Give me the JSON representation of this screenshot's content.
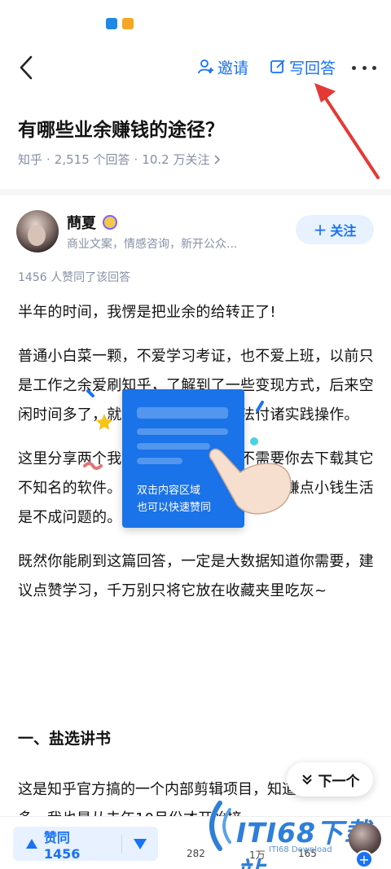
{
  "nav": {
    "invite_label": "邀请",
    "write_answer_label": "写回答"
  },
  "question": {
    "title": "有哪些业余赚钱的途径？",
    "source": "知乎",
    "answer_count": "2,515 个回答",
    "follower_count": "10.2 万关注"
  },
  "author": {
    "name": "蔄夏",
    "bio": "商业文案，情感咨询，新开公众...",
    "follow_label": "关注"
  },
  "answer": {
    "likers_text": "1456 人赞同了该回答",
    "paragraphs": [
      "半年的时间，我愣是把业余的给转正了!",
      "普通小白菜一颗，不爱学习考证，也不爱上班，以前只是工作之余爱刷知乎，了解到了一些变现方式，后来空闲时间多了，就把了解到的这些方法付诸实践操作。",
      "这里分享两个我觉得不错的副业，不需要你去下载其它不知名的软件。就在知乎，稍稍努力一点赚点小钱生活是不成问题的。",
      "既然你能刷到这篇回答，一定是大数据知道你需要，建议点赞学习，千万别只将它放在收藏夹里吃灰~"
    ],
    "section_title": "一、盐选讲书",
    "last_paragraph": "这是知乎官方搞的一个内部剪辑项目，知道的人并不多，我也是从去年10月份才开始接"
  },
  "tip": {
    "line1": "双击内容区域",
    "line2": "也可以快速赞同"
  },
  "next_label": "下一个",
  "bottom": {
    "vote_label": "赞同 1456",
    "comments": "282",
    "favorites": "1万",
    "likes": "165"
  },
  "watermark": {
    "main": "ITI68下载站",
    "sub": "ITI68 Download"
  },
  "colors": {
    "accent": "#1772f6",
    "arrow": "#e53935",
    "tip_card": "#1a73e8"
  }
}
